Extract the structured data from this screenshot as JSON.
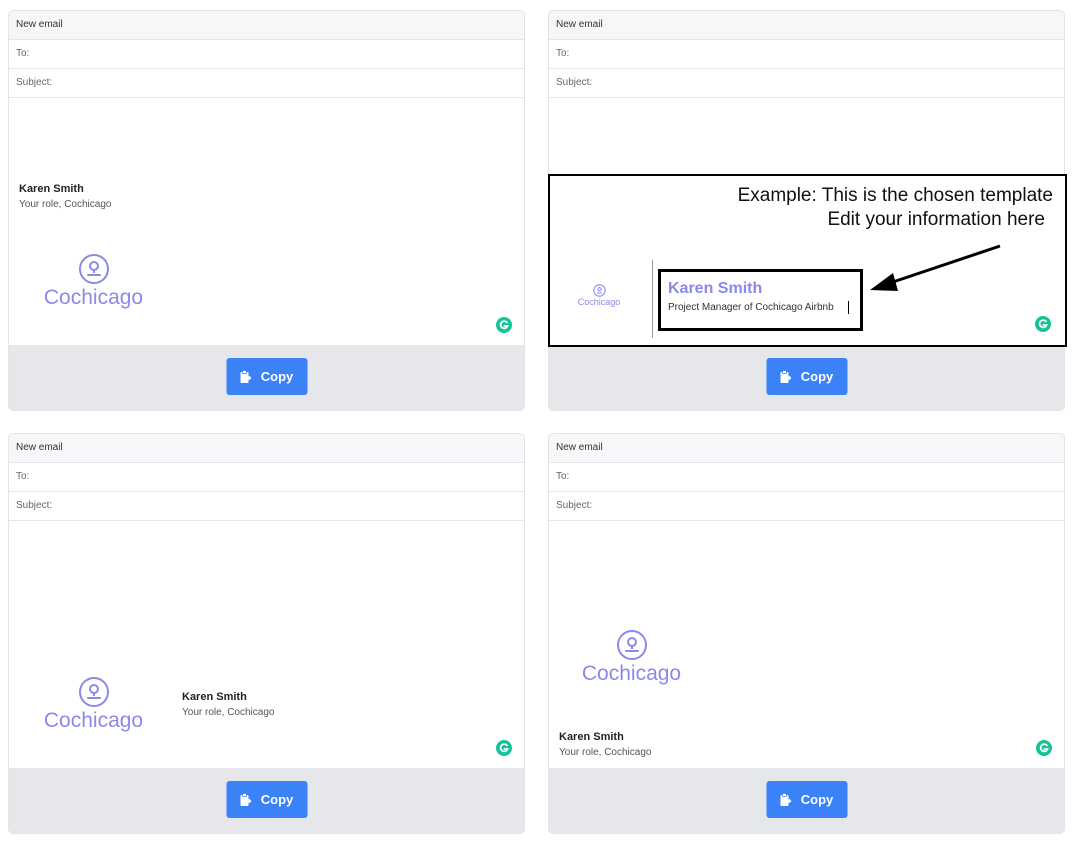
{
  "cards": [
    {
      "header": "New email",
      "to_label": "To:",
      "subject_label": "Subject:",
      "name": "Karen Smith",
      "role": "Your role, Cochicago",
      "logo_text": "Cochicago",
      "copy_label": "Copy"
    },
    {
      "header": "New email",
      "to_label": "To:",
      "subject_label": "Subject:",
      "copy_label": "Copy"
    },
    {
      "header": "New email",
      "to_label": "To:",
      "subject_label": "Subject:",
      "name": "Karen Smith",
      "role": "Your role, Cochicago",
      "logo_text": "Cochicago",
      "copy_label": "Copy"
    },
    {
      "header": "New email",
      "to_label": "To:",
      "subject_label": "Subject:",
      "name": "Karen Smith",
      "role": "Your role, Cochicago",
      "logo_text": "Cochicago",
      "copy_label": "Copy"
    }
  ],
  "example": {
    "caption_line1": "Example: This is the chosen template",
    "caption_line2": "Edit your information here",
    "logo_text": "Cochicago",
    "name": "Karen Smith",
    "role": "Project Manager of Cochicago Airbnb"
  },
  "colors": {
    "accent": "#3b82f6",
    "logo": "#8b89ea",
    "grammarly": "#15c39a",
    "footer": "#e5e7eb"
  },
  "icons": {
    "copy": "clipboard-icon",
    "grammarly": "grammarly-icon",
    "logo": "location-pin-icon",
    "arrow": "arrow-icon"
  }
}
